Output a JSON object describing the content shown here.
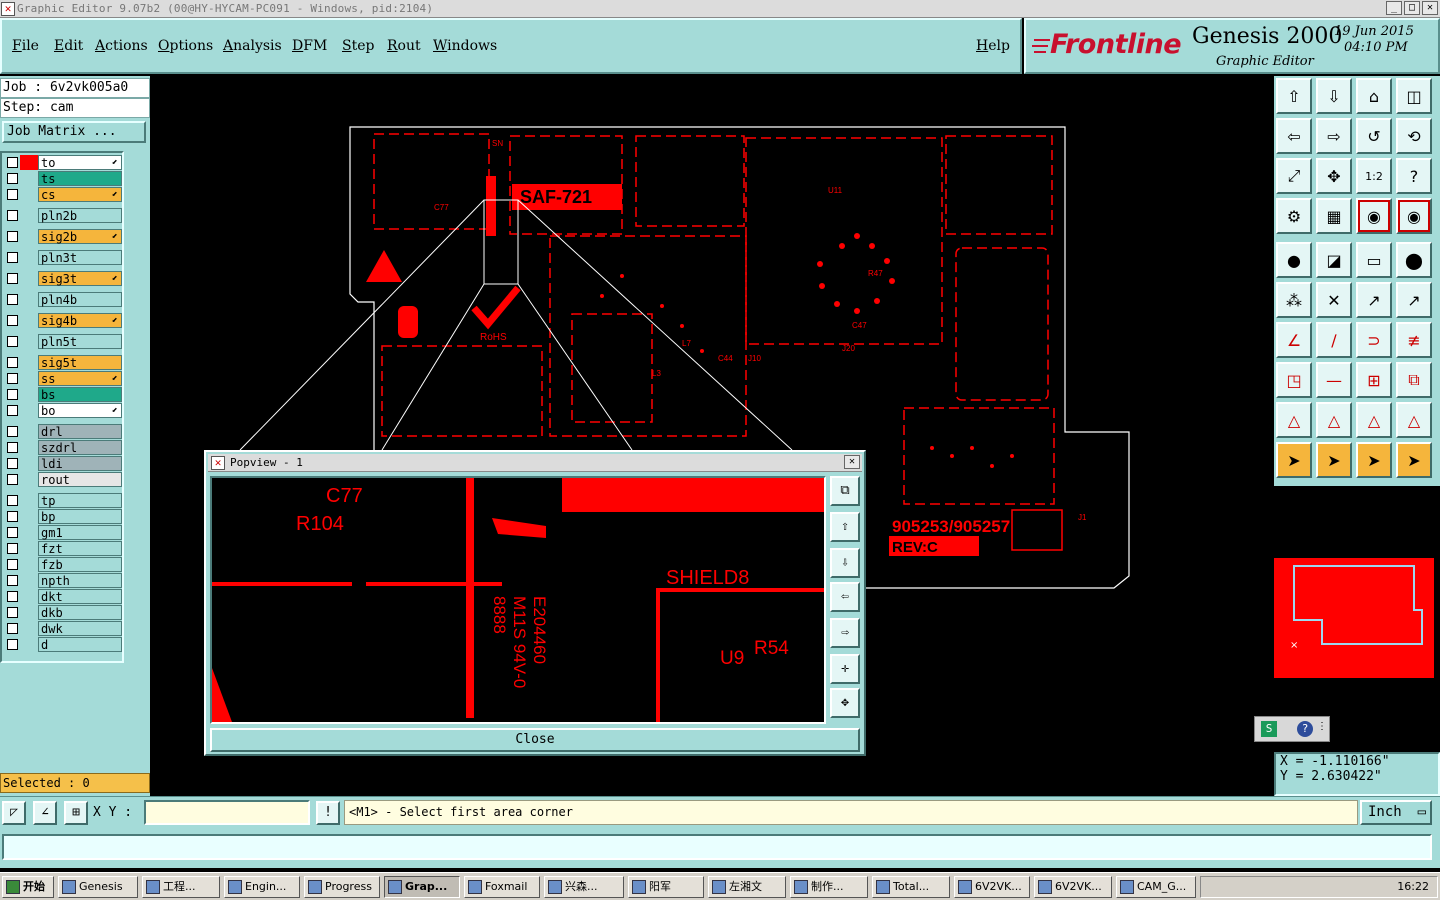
{
  "window": {
    "title": "Graphic Editor 9.07b2 (00@HY-HYCAM-PC091 - Windows, pid:2104)"
  },
  "menu": {
    "items": [
      "File",
      "Edit",
      "Actions",
      "Options",
      "Analysis",
      "DFM",
      "Step",
      "Rout",
      "Windows"
    ],
    "help": "Help"
  },
  "logo": {
    "brand": "Frontline",
    "product": "Genesis 2000",
    "subtitle": "Graphic Editor",
    "date": "19 Jun 2015",
    "time": "04:10 PM"
  },
  "job": {
    "job_label": "Job : 6v2vk005a0",
    "step_label": "Step: cam",
    "matrix_button": "Job Matrix ..."
  },
  "layers": [
    {
      "name": "to",
      "color": "#ffffff",
      "sel_color": "#ff0000",
      "arrow": true
    },
    {
      "name": "ts",
      "color": "#1fa98a",
      "sel_color": "",
      "arrow": false
    },
    {
      "name": "cs",
      "color": "#f5b53c",
      "sel_color": "",
      "arrow": true
    },
    {
      "name": "pln2b",
      "color": "#a4dbd8",
      "sel_color": "",
      "arrow": false
    },
    {
      "name": "sig2b",
      "color": "#f5b53c",
      "sel_color": "",
      "arrow": true
    },
    {
      "name": "pln3t",
      "color": "#a4dbd8",
      "sel_color": "",
      "arrow": false
    },
    {
      "name": "sig3t",
      "color": "#f5b53c",
      "sel_color": "",
      "arrow": true
    },
    {
      "name": "pln4b",
      "color": "#a4dbd8",
      "sel_color": "",
      "arrow": false
    },
    {
      "name": "sig4b",
      "color": "#f5b53c",
      "sel_color": "",
      "arrow": true
    },
    {
      "name": "pln5t",
      "color": "#a4dbd8",
      "sel_color": "",
      "arrow": false
    },
    {
      "name": "sig5t",
      "color": "#f5b53c",
      "sel_color": "",
      "arrow": false
    },
    {
      "name": "ss",
      "color": "#f5b53c",
      "sel_color": "",
      "arrow": true
    },
    {
      "name": "bs",
      "color": "#1fa98a",
      "sel_color": "",
      "arrow": false
    },
    {
      "name": "bo",
      "color": "#ffffff",
      "sel_color": "",
      "arrow": true
    },
    {
      "name": "drl",
      "color": "#9fb3b8",
      "sel_color": "",
      "arrow": false
    },
    {
      "name": "szdrl",
      "color": "#9fb3b8",
      "sel_color": "",
      "arrow": false
    },
    {
      "name": "ldi",
      "color": "#9fb3b8",
      "sel_color": "",
      "arrow": false
    },
    {
      "name": "rout",
      "color": "#e6e6e6",
      "sel_color": "",
      "arrow": false
    },
    {
      "name": "tp",
      "color": "#a4dbd8",
      "sel_color": "",
      "arrow": false
    },
    {
      "name": "bp",
      "color": "#a4dbd8",
      "sel_color": "",
      "arrow": false
    },
    {
      "name": "gm1",
      "color": "#a4dbd8",
      "sel_color": "",
      "arrow": false
    },
    {
      "name": "fzt",
      "color": "#a4dbd8",
      "sel_color": "",
      "arrow": false
    },
    {
      "name": "fzb",
      "color": "#a4dbd8",
      "sel_color": "",
      "arrow": false
    },
    {
      "name": "npth",
      "color": "#a4dbd8",
      "sel_color": "",
      "arrow": false
    },
    {
      "name": "dkt",
      "color": "#a4dbd8",
      "sel_color": "",
      "arrow": false
    },
    {
      "name": "dkb",
      "color": "#a4dbd8",
      "sel_color": "",
      "arrow": false
    },
    {
      "name": "dwk",
      "color": "#a4dbd8",
      "sel_color": "",
      "arrow": false
    },
    {
      "name": "d",
      "color": "#a4dbd8",
      "sel_color": "",
      "arrow": false
    }
  ],
  "status": {
    "selected": "Selected : 0",
    "xy_label": "X Y :",
    "xy_value": "",
    "prompt": "<M1> - Select first area corner",
    "units": "Inch",
    "coord_x": "X = -1.110166\"",
    "coord_y": "Y = 2.630422\""
  },
  "board_labels": {
    "top_marking": "SAF-721",
    "bottom_marking": "905253/905257",
    "rev": "REV:C",
    "rohs": "RoHS",
    "refs": [
      "C77",
      "R104",
      "U11",
      "J1",
      "J10",
      "J20",
      "SN",
      "SHIELD8",
      "U9",
      "R54",
      "L3",
      "L7",
      "C47",
      "R47",
      "C44"
    ]
  },
  "popview": {
    "title": "Popview - 1",
    "close_label": "Close",
    "labels": [
      "C77",
      "R104",
      "SHIELD8",
      "U9",
      "R54",
      "E204460",
      "M11S 94V-0",
      "8888"
    ]
  },
  "taskbar": {
    "start": "开始",
    "tasks": [
      "Genesis",
      "工程...",
      "Engin...",
      "Progress",
      "Grap...",
      "Foxmail",
      "兴森...",
      "阳军",
      "左湘文",
      "制作...",
      "Total...",
      "6V2VK...",
      "6V2VK...",
      "CAM_G..."
    ],
    "clock": "16:22"
  },
  "colors": {
    "panel": "#a4dbd8",
    "copper": "#ff0000",
    "outline": "#ffffff",
    "accent": "#f5b53c"
  }
}
